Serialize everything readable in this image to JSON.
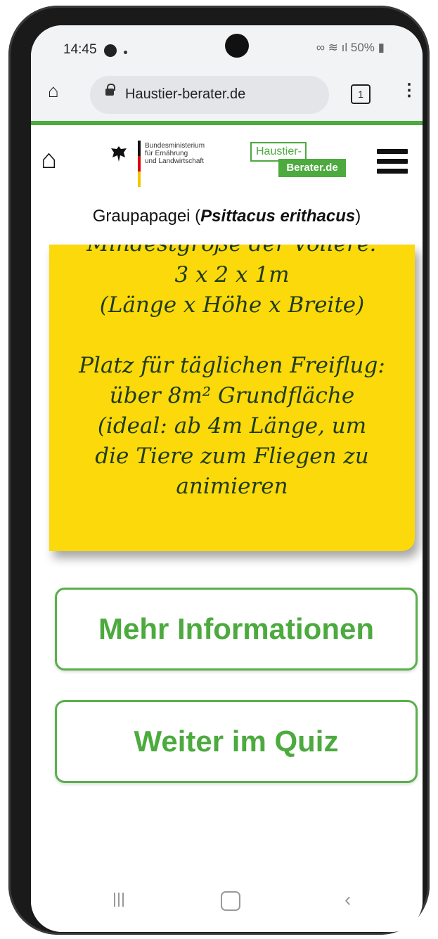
{
  "status_bar": {
    "time": "14:45",
    "battery": "50%"
  },
  "browser": {
    "url": "Haustier-berater.de",
    "tab_count": "1"
  },
  "header": {
    "ministry_line1": "Bundesministerium",
    "ministry_line2": "für Ernährung",
    "ministry_line3": "und Landwirtschaft",
    "logo_top": "Haustier-",
    "logo_bottom": "Berater.de"
  },
  "page": {
    "title_plain_start": "Graupapagei (",
    "title_italic": "Psittacus erithacus",
    "title_plain_end": ")"
  },
  "note": {
    "cut_line": "Mindestgröße der Voliere:",
    "line1": "3 x 2 x 1m",
    "line2": "(Länge x Höhe x Breite)",
    "line3": "Platz für täglichen Freiflug:",
    "line4": "über 8m² Grundfläche",
    "line5": "(ideal: ab 4m Länge, um",
    "line6": "die Tiere zum Fliegen zu",
    "line7": "animieren"
  },
  "buttons": {
    "more_info": "Mehr Informationen",
    "continue_quiz": "Weiter im Quiz"
  },
  "colors": {
    "brand_green": "#4caa3e",
    "note_yellow": "#fbd90a"
  }
}
